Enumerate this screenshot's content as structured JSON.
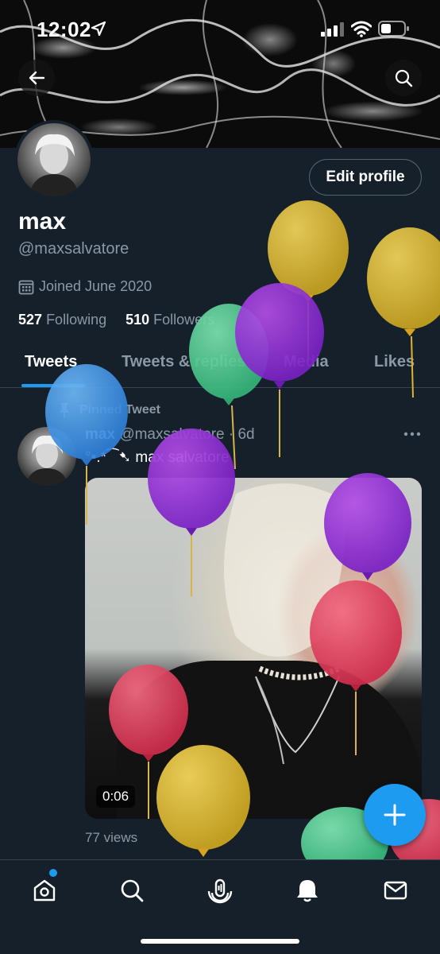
{
  "status_bar": {
    "time": "12:02"
  },
  "profile": {
    "display_name": "max",
    "handle": "@maxsalvatore",
    "joined": "Joined June 2020",
    "following_count": "527",
    "following_label": "Following",
    "followers_count": "510",
    "followers_label": "Followers",
    "edit_button_label": "Edit profile"
  },
  "tabs": [
    {
      "label": "Tweets",
      "active": true
    },
    {
      "label": "Tweets & replies",
      "active": false
    },
    {
      "label": "Media",
      "active": false
    },
    {
      "label": "Likes",
      "active": false
    }
  ],
  "tweet": {
    "pinned_label": "Pinned Tweet",
    "author_name": "max",
    "author_handle": "@maxsalvatore",
    "age": "· 6d",
    "text": "°•.*⁀➷ max salvatore",
    "video_duration": "0:06",
    "views": "77 views"
  },
  "icons": {
    "back": "arrow-left-icon",
    "search": "search-icon",
    "calendar": "calendar-icon",
    "pin": "pin-icon",
    "more": "more-horizontal-icon",
    "compose": "plus-icon",
    "nav": [
      "home-icon",
      "search-icon",
      "spaces-icon",
      "notifications-icon",
      "messages-icon"
    ]
  },
  "colors": {
    "background": "#15202b",
    "accent": "#1d9bf0",
    "muted_text": "#8b98a5",
    "border": "#38444d"
  }
}
